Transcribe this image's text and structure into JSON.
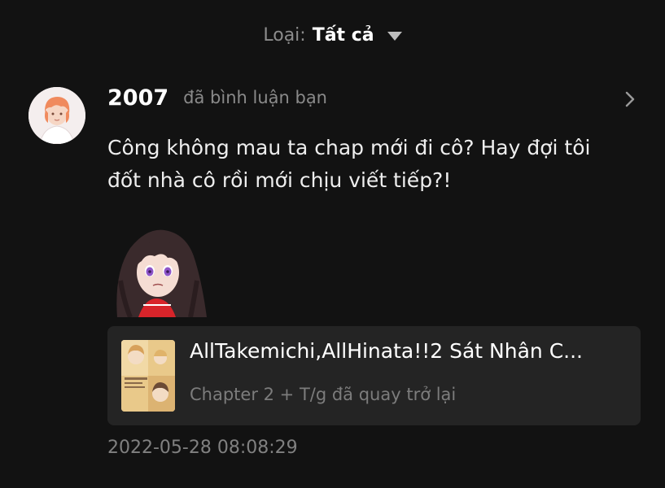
{
  "filter": {
    "label": "Loại:",
    "value": "Tất cả",
    "caret_icon": "caret-down-icon"
  },
  "notification": {
    "avatar_icon": "user-avatar",
    "username": "2007",
    "action": "đã bình luận bạn",
    "chevron_icon": "chevron-right-icon",
    "comment_line1": "Công không mau ta chap mới đi cô? Hay đợi tôi",
    "comment_line2": "đốt nhà cô rồi mới chịu viết tiếp?!",
    "sticker_icon": "anime-girl-sticker",
    "card": {
      "cover_icon": "story-cover-thumbnail",
      "title": "AllTakemichi,AllHinata!!2 Sát Nhân C...",
      "subtitle": "Chapter 2 + T/g đã quay trở lại"
    },
    "timestamp": "2022-05-28 08:08:29"
  },
  "colors": {
    "background": "#121212",
    "card_background": "#242424",
    "primary_text": "#eeeeee",
    "secondary_text": "#808080"
  }
}
